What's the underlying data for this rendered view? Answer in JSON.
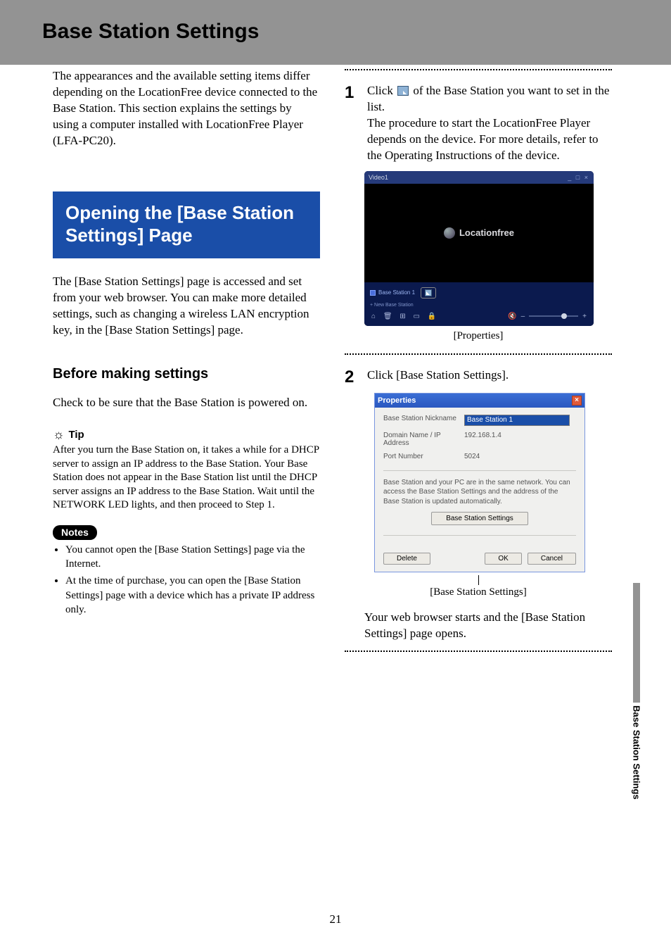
{
  "page": {
    "title": "Base Station Settings",
    "number": "21",
    "side_tab": "Base Station Settings"
  },
  "left": {
    "intro": "The appearances and the available setting items differ depending on the LocationFree device connected to the Base Station. This section explains the settings by using a computer installed with LocationFree Player (LFA-PC20).",
    "blue_box": "Opening the [Base Station Settings] Page",
    "para1": "The [Base Station Settings] page is accessed and set from your web browser. You can make more detailed settings, such as changing a wireless LAN encryption key, in the [Base Station Settings] page.",
    "h_before": "Before making settings",
    "para2": "Check to be sure that the Base Station is powered on.",
    "tip_label": "Tip",
    "tip_body": "After you turn the Base Station on, it takes a while for a DHCP server to assign an IP address to the Base Station. Your Base Station does not appear in the Base Station list until the DHCP server assigns an IP address to the Base Station. Wait until the NETWORK LED lights, and then proceed to Step 1.",
    "notes_label": "Notes",
    "notes": [
      "You cannot open the [Base Station Settings] page via the Internet.",
      "At the time of purchase, you can open the [Base Station Settings] page with a device which has a private IP address only."
    ]
  },
  "right": {
    "step1": {
      "num": "1",
      "text_a": "Click ",
      "text_b": " of the Base Station you want to set in the list.",
      "text_c": "The procedure to start the LocationFree Player depends on the device. For more details, refer to the Operating Instructions of the device."
    },
    "app_window": {
      "title": "Video1",
      "window_controls": "_ □ ×",
      "logo_text": "Locationfree",
      "list_item": "Base Station 1",
      "add_link": "+ New Base Station",
      "caption": "[Properties]"
    },
    "step2": {
      "num": "2",
      "text": "Click [Base Station Settings]."
    },
    "dialog": {
      "title": "Properties",
      "close": "×",
      "fields": {
        "nickname_label": "Base Station Nickname",
        "nickname_value": "Base Station 1",
        "domain_label": "Domain Name / IP Address",
        "domain_value": "192.168.1.4",
        "port_label": "Port Number",
        "port_value": "5024"
      },
      "message": "Base Station and your PC are in the same network. You can access the Base Station Settings and the address of the Base Station is updated automatically.",
      "bss_button": "Base Station Settings",
      "delete_btn": "Delete",
      "ok_btn": "OK",
      "cancel_btn": "Cancel",
      "caption": "[Base Station Settings]"
    },
    "closing": "Your web browser starts and the [Base Station Settings] page opens."
  }
}
